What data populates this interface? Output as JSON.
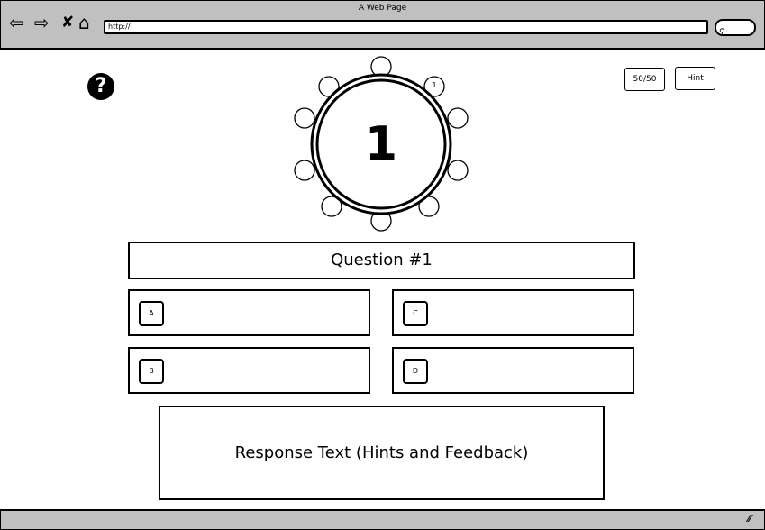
{
  "browser": {
    "title": "A Web Page",
    "url": "http://",
    "icons": [
      "back-arrow-icon",
      "forward-arrow-icon",
      "close-x-icon",
      "home-icon",
      "search-icon"
    ]
  },
  "help_icon": "?",
  "lifelines": {
    "fifty_fifty": "50/50",
    "hint": "Hint"
  },
  "timer": {
    "value": "1",
    "marker_label": "1"
  },
  "question": "Question #1",
  "answers": {
    "a": "A",
    "b": "B",
    "c": "C",
    "d": "D"
  },
  "response": "Response Text (Hints and Feedback)"
}
